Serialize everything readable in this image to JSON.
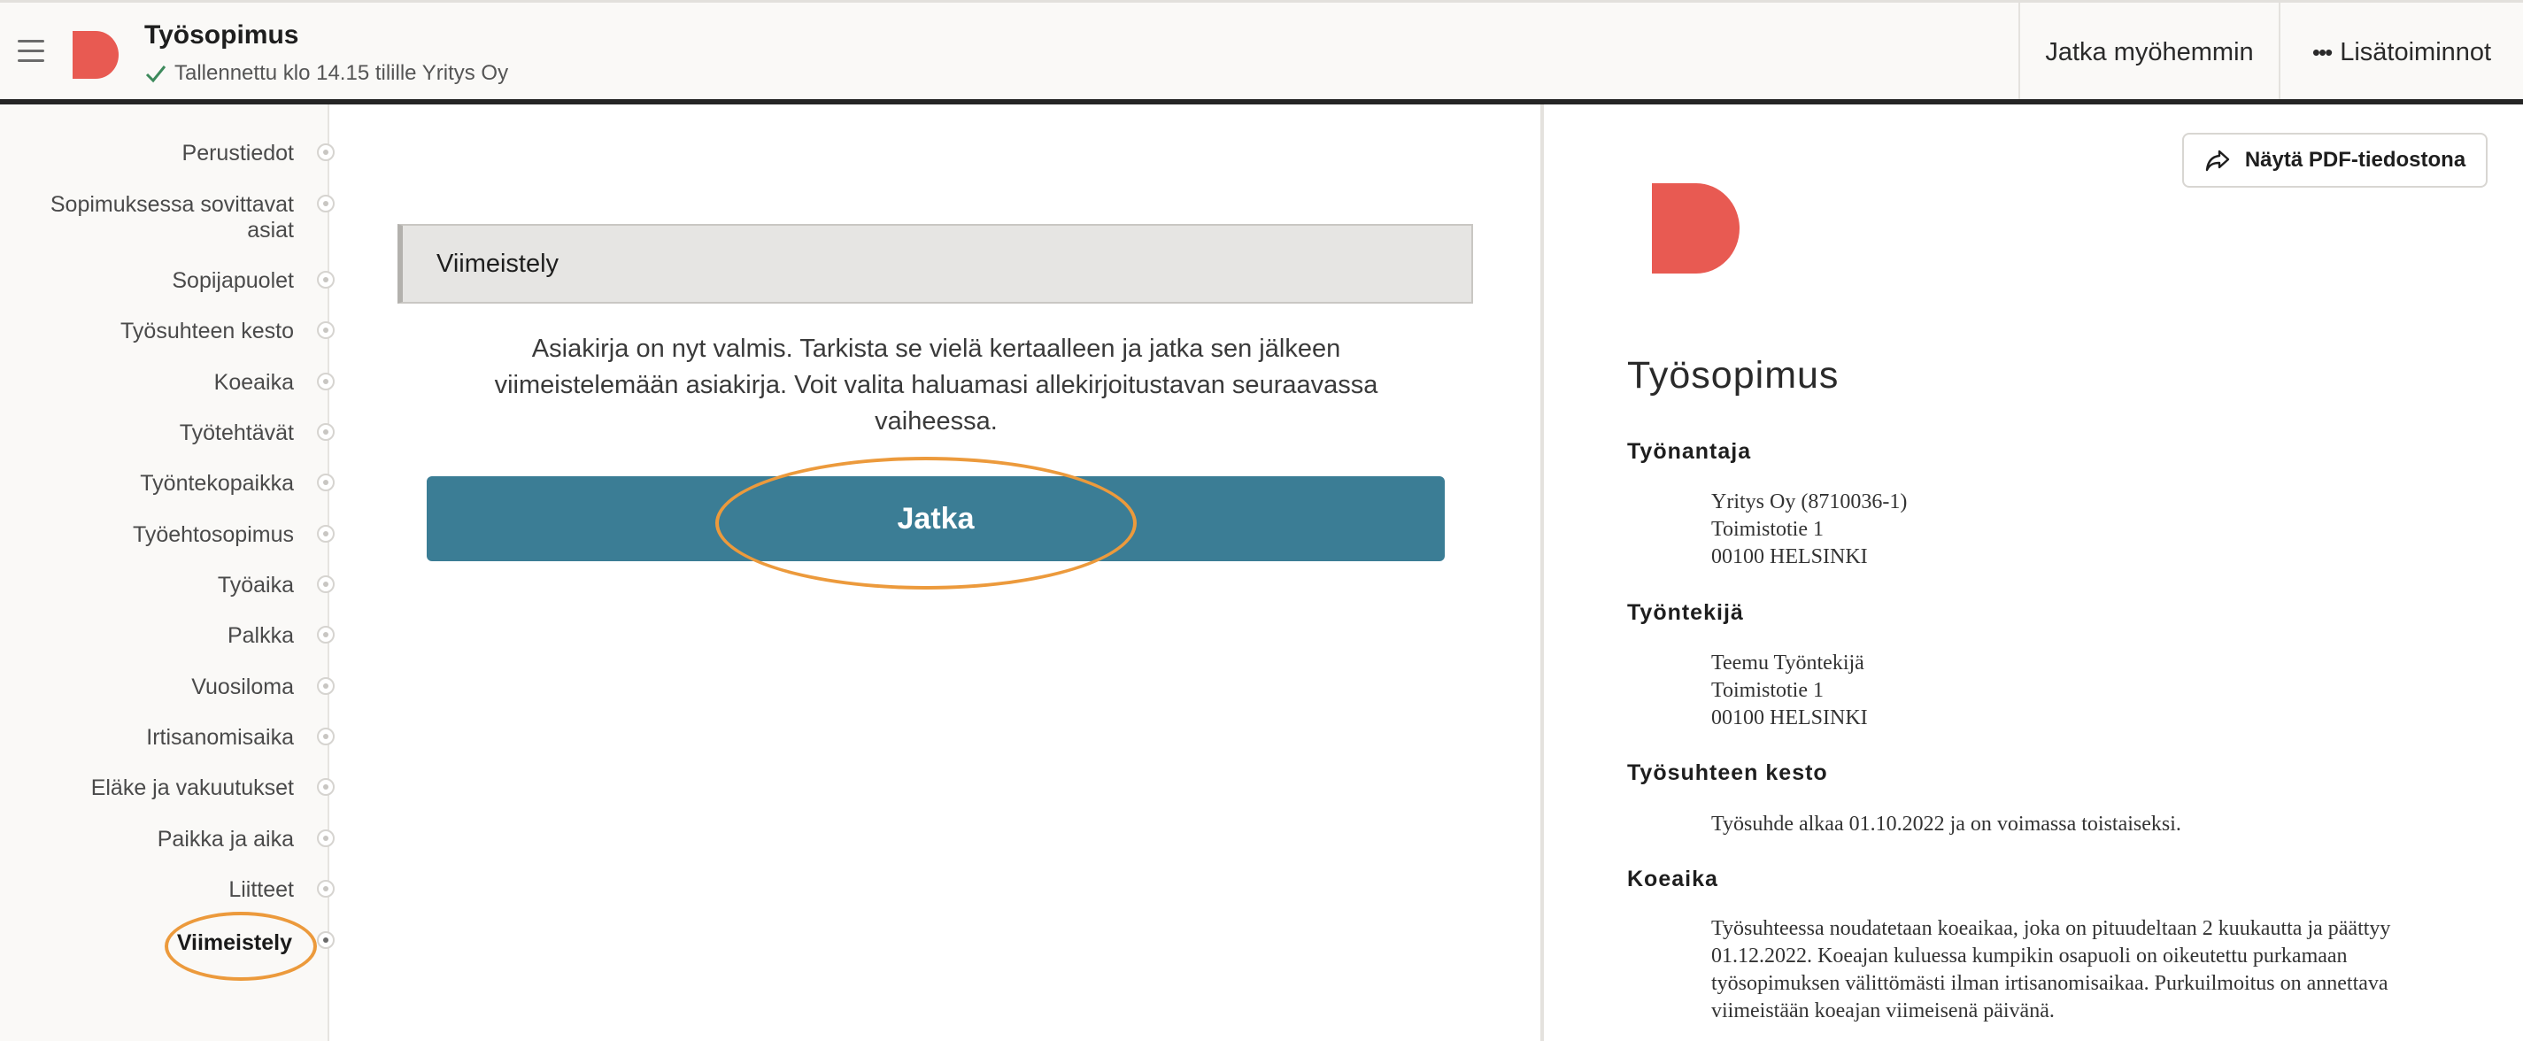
{
  "header": {
    "title": "Työsopimus",
    "saved_text": "Tallennettu klo 14.15 tilille Yritys Oy",
    "continue_later": "Jatka myöhemmin",
    "more_actions": "Lisätoiminnot"
  },
  "colors": {
    "brand_red": "#e85a52",
    "primary_button": "#3b7d95",
    "highlight_orange": "#ec9a3c"
  },
  "sidebar": {
    "items": [
      {
        "label": "Perustiedot"
      },
      {
        "label": "Sopimuksessa sovittavat asiat"
      },
      {
        "label": "Sopijapuolet"
      },
      {
        "label": "Työsuhteen kesto"
      },
      {
        "label": "Koeaika"
      },
      {
        "label": "Työtehtävät"
      },
      {
        "label": "Työntekopaikka"
      },
      {
        "label": "Työehtosopimus"
      },
      {
        "label": "Työaika"
      },
      {
        "label": "Palkka"
      },
      {
        "label": "Vuosiloma"
      },
      {
        "label": "Irtisanomisaika"
      },
      {
        "label": "Eläke ja vakuutukset"
      },
      {
        "label": "Paikka ja aika"
      },
      {
        "label": "Liitteet"
      },
      {
        "label": "Viimeistely"
      }
    ],
    "active": "Viimeistely"
  },
  "main": {
    "section_title": "Viimeistely",
    "instructions": "Asiakirja on nyt valmis. Tarkista se vielä kertaalleen ja jatka sen jälkeen viimeistelemään asiakirja. Voit valita haluamasi allekirjoitustavan seuraavassa vaiheessa.",
    "continue_button": "Jatka"
  },
  "preview": {
    "pdf_button": "Näytä PDF-tiedostona",
    "title": "Työsopimus",
    "sections": [
      {
        "heading": "Työnantaja",
        "lines": [
          "Yritys Oy (8710036-1)",
          "Toimistotie 1",
          "00100 HELSINKI"
        ]
      },
      {
        "heading": "Työntekijä",
        "lines": [
          "Teemu Työntekijä",
          "Toimistotie 1",
          "00100 HELSINKI"
        ]
      },
      {
        "heading": "Työsuhteen kesto",
        "lines": [
          "Työsuhde alkaa 01.10.2022 ja on voimassa toistaiseksi."
        ]
      },
      {
        "heading": "Koeaika",
        "lines": [
          "Työsuhteessa noudatetaan koeaikaa, joka on pituudeltaan 2 kuukautta ja päättyy 01.12.2022. Koeajan kuluessa kumpikin osapuoli on oikeutettu purkamaan työsopimuksen välittömästi ilman irtisanomisaikaa. Purkuilmoitus on annettava viimeistään koeajan viimeisenä päivänä."
        ]
      }
    ]
  }
}
